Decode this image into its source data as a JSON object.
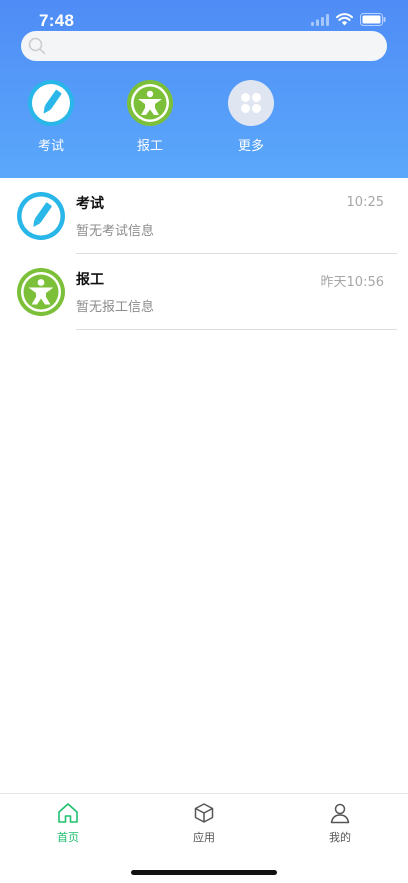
{
  "status_bar": {
    "time": "7:48"
  },
  "search": {
    "placeholder": ""
  },
  "shortcuts": [
    {
      "label": "考试",
      "icon": "pencil-icon",
      "color": "#29b6e8"
    },
    {
      "label": "报工",
      "icon": "worker-icon",
      "color": "#7cc03a"
    },
    {
      "label": "更多",
      "icon": "more-grid-icon",
      "color": "#dfe6f1"
    }
  ],
  "messages": [
    {
      "title": "考试",
      "time": "10:25",
      "preview": "暂无考试信息",
      "icon": "pencil-icon",
      "color": "#29b6e8"
    },
    {
      "title": "报工",
      "time": "昨天10:56",
      "preview": "暂无报工信息",
      "icon": "worker-icon",
      "color": "#7cc03a"
    }
  ],
  "tabs": [
    {
      "label": "首页",
      "icon": "home-icon",
      "active": true
    },
    {
      "label": "应用",
      "icon": "box-icon",
      "active": false
    },
    {
      "label": "我的",
      "icon": "person-icon",
      "active": false
    }
  ],
  "colors": {
    "header_gradient_top": "#4f8cf6",
    "header_gradient_bottom": "#5aa8fb",
    "active_tab": "#1fbf6e"
  }
}
